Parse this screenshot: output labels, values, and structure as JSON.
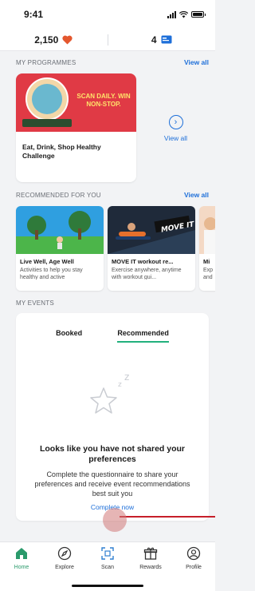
{
  "status": {
    "time": "9:41"
  },
  "summary": {
    "points": "2,150",
    "notifications": "4"
  },
  "programmes": {
    "title": "MY PROGRAMMES",
    "view_all": "View all",
    "card": {
      "tagline": "SCAN DAILY. WIN NON-STOP.",
      "name": "Eat, Drink, Shop Healthy Challenge"
    },
    "side_link": "View all"
  },
  "recommended": {
    "title": "RECOMMENDED FOR YOU",
    "view_all": "View all",
    "cards": [
      {
        "title": "Live Well, Age Well",
        "desc": "Activities to help you stay healthy and active"
      },
      {
        "title": "MOVE IT workout re...",
        "desc": "Exercise anywhere, anytime with workout gui..."
      },
      {
        "title": "Mi",
        "desc": "Exp and"
      }
    ],
    "move_it_text": "MOVE IT"
  },
  "events": {
    "title": "MY EVENTS",
    "tabs": [
      "Booked",
      "Recommended"
    ],
    "empty_title": "Looks like you have not shared your preferences",
    "empty_sub": "Complete the questionnaire to share your preferences and receive event recommendations best suit you",
    "empty_link": "Complete now"
  },
  "tabbar": [
    {
      "label": "Home",
      "icon": "home-icon"
    },
    {
      "label": "Explore",
      "icon": "compass-icon"
    },
    {
      "label": "Scan",
      "icon": "scan-icon"
    },
    {
      "label": "Rewards",
      "icon": "gift-icon"
    },
    {
      "label": "Profile",
      "icon": "profile-icon"
    }
  ],
  "colors": {
    "accent": "#1e6fd9",
    "active_tab": "#2a9a6b",
    "heart": "#e4572e",
    "banner": "#e03a45"
  }
}
